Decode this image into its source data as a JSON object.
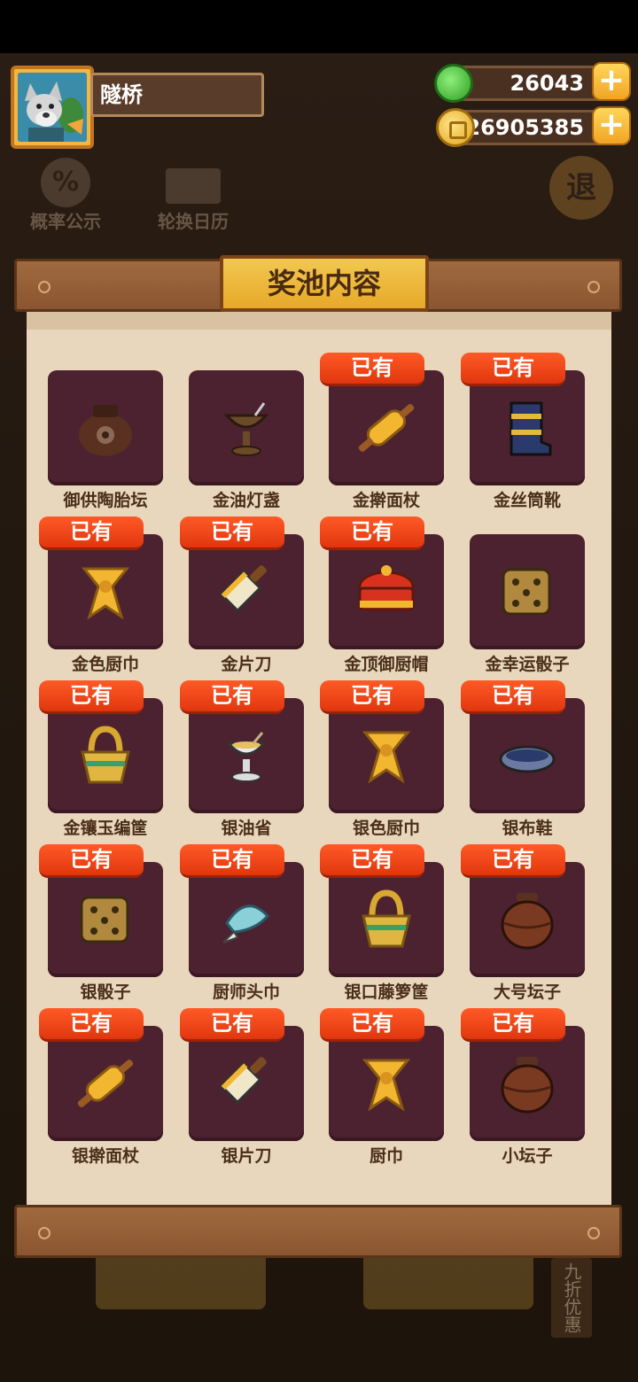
{
  "player": {
    "name": "隧桥"
  },
  "currency": {
    "gems": "26043",
    "coins": "26905385"
  },
  "background": {
    "prob_label": "概率公示",
    "calendar_label": "轮换日历",
    "exit_label": "退",
    "side_label": "九折优惠"
  },
  "panel": {
    "title": "奖池内容",
    "owned_label": "已有"
  },
  "items": [
    {
      "name": "御供陶胎坛",
      "owned": false,
      "icon": "clay-jar-icon"
    },
    {
      "name": "金油灯盏",
      "owned": false,
      "icon": "oil-lamp-icon"
    },
    {
      "name": "金擀面杖",
      "owned": true,
      "icon": "rolling-pin-icon"
    },
    {
      "name": "金丝筒靴",
      "owned": true,
      "icon": "boot-icon"
    },
    {
      "name": "金色厨巾",
      "owned": true,
      "icon": "scarf-icon"
    },
    {
      "name": "金片刀",
      "owned": true,
      "icon": "cleaver-icon"
    },
    {
      "name": "金顶御厨帽",
      "owned": true,
      "icon": "chef-hat-icon"
    },
    {
      "name": "金幸运骰子",
      "owned": false,
      "icon": "dice-icon"
    },
    {
      "name": "金镶玉编筐",
      "owned": true,
      "icon": "basket-icon"
    },
    {
      "name": "银油省",
      "owned": true,
      "icon": "oil-cup-icon"
    },
    {
      "name": "银色厨巾",
      "owned": true,
      "icon": "scarf-icon"
    },
    {
      "name": "银布鞋",
      "owned": true,
      "icon": "shoe-icon"
    },
    {
      "name": "银骰子",
      "owned": true,
      "icon": "dice-icon"
    },
    {
      "name": "厨师头巾",
      "owned": true,
      "icon": "bandana-icon"
    },
    {
      "name": "银口藤箩筐",
      "owned": true,
      "icon": "basket-icon"
    },
    {
      "name": "大号坛子",
      "owned": true,
      "icon": "jar-icon"
    },
    {
      "name": "银擀面杖",
      "owned": true,
      "icon": "rolling-pin-icon"
    },
    {
      "name": "银片刀",
      "owned": true,
      "icon": "cleaver-icon"
    },
    {
      "name": "厨巾",
      "owned": true,
      "icon": "scarf-icon"
    },
    {
      "name": "小坛子",
      "owned": true,
      "icon": "jar-icon"
    }
  ]
}
